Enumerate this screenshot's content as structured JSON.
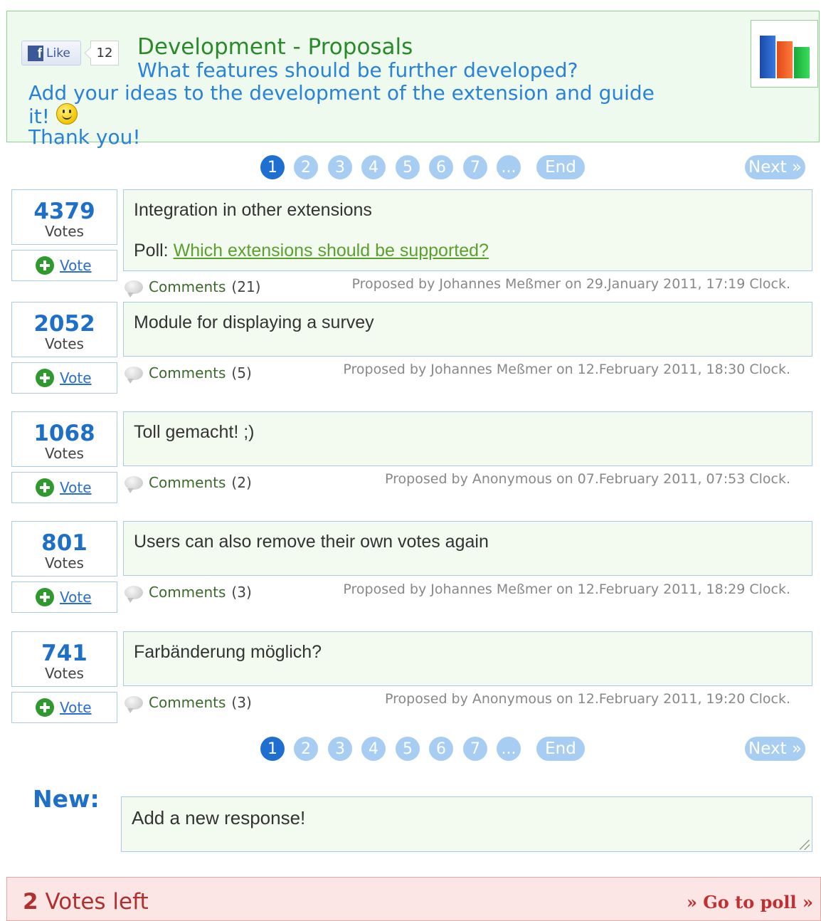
{
  "header": {
    "like_label": "Like",
    "like_count": "12",
    "title": "Development - Proposals",
    "subtitle": "What features should be further developed?",
    "description_line1": "Add your ideas to the development of the extension and guide it!",
    "description_line2": "Thank you!"
  },
  "pagination": {
    "pages": [
      "1",
      "2",
      "3",
      "4",
      "5",
      "6",
      "7"
    ],
    "active_page": "1",
    "ellipsis": "...",
    "end_label": "End",
    "next_label": "Next »"
  },
  "proposals": [
    {
      "votes": "4379",
      "votes_label": "Votes",
      "vote_label": "Vote",
      "title": "Integration in other extensions",
      "poll_prefix": "Poll:",
      "poll_link": "Which extensions should be supported?",
      "comments_label": "Comments",
      "comments_count": "(21)",
      "proposed": "Proposed by Johannes Meßmer on 29.January 2011, 17:19 Clock."
    },
    {
      "votes": "2052",
      "votes_label": "Votes",
      "vote_label": "Vote",
      "title": "Module for displaying a survey",
      "comments_label": "Comments",
      "comments_count": "(5)",
      "proposed": "Proposed by Johannes Meßmer on 12.February 2011, 18:30 Clock."
    },
    {
      "votes": "1068",
      "votes_label": "Votes",
      "vote_label": "Vote",
      "title": "Toll gemacht! ;)",
      "comments_label": "Comments",
      "comments_count": "(2)",
      "proposed": "Proposed by Anonymous on 07.February 2011, 07:53 Clock."
    },
    {
      "votes": "801",
      "votes_label": "Votes",
      "vote_label": "Vote",
      "title": "Users can also remove their own votes again",
      "comments_label": "Comments",
      "comments_count": "(3)",
      "proposed": "Proposed by Johannes Meßmer on 12.February 2011, 18:29 Clock."
    },
    {
      "votes": "741",
      "votes_label": "Votes",
      "vote_label": "Vote",
      "title": "Farbänderung möglich?",
      "comments_label": "Comments",
      "comments_count": "(3)",
      "proposed": "Proposed by Anonymous on 12.February 2011, 19:20 Clock."
    }
  ],
  "new_response": {
    "label": "New:",
    "placeholder": "Add a new response!"
  },
  "footer": {
    "votes_left_count": "2",
    "votes_left_label": "Votes left",
    "go_to_poll": "» Go to poll »"
  },
  "colors": {
    "header_bg": "#eefaee",
    "accent_blue": "#1e6fc8",
    "page_inactive": "#a8cdf2",
    "footer_bg": "#fbe5e5",
    "footer_text": "#b03030"
  }
}
